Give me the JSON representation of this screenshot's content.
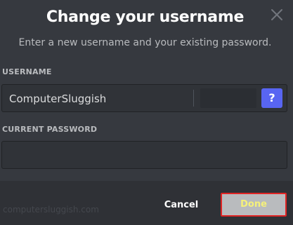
{
  "modal": {
    "title": "Change your username",
    "subtitle": "Enter a new username and your existing password."
  },
  "fields": {
    "username": {
      "label": "USERNAME",
      "value": "ComputerSluggish",
      "help_label": "?"
    },
    "password": {
      "label": "CURRENT PASSWORD",
      "value": ""
    }
  },
  "footer": {
    "watermark": "computersluggish.com",
    "cancel_label": "Cancel",
    "done_label": "Done"
  },
  "icons": {
    "close": "close-icon"
  },
  "colors": {
    "background": "#36393f",
    "footer": "#2f3136",
    "input_bg": "#303338",
    "help_button": "#5865f2",
    "done_button": "#b9bbbe",
    "done_highlight_border": "#e02424",
    "done_text": "#f5f07a"
  }
}
